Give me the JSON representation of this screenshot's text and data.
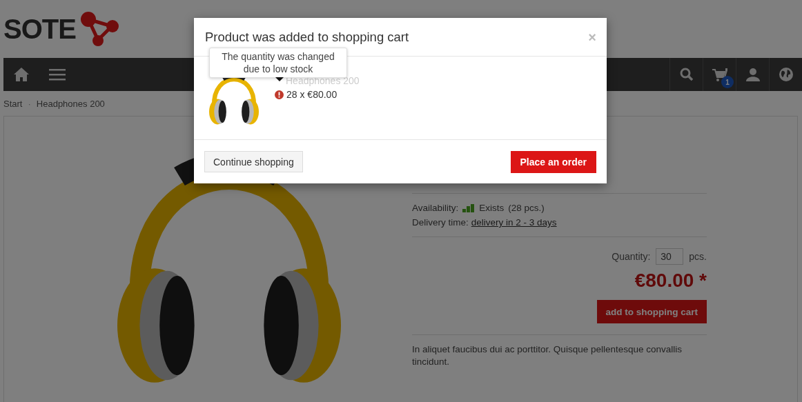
{
  "logo": {
    "text": "SOTE"
  },
  "nav": {
    "cart_badge": "1"
  },
  "breadcrumb": {
    "separator": "·",
    "items": [
      {
        "label": "Start"
      },
      {
        "label": "Headphones 200"
      }
    ]
  },
  "product": {
    "availability_label": "Availability:",
    "availability": "Exists",
    "stock": "(28 pcs.)",
    "delivery_label": "Delivery time:",
    "delivery_link": "delivery in 2 - 3 days",
    "quantity_label": "Quantity:",
    "quantity": "30",
    "quantity_unit": "pcs.",
    "price": "€80.00 *",
    "add_to_cart": "add to shopping cart",
    "description": "In aliquet faucibus dui ac porttitor. Quisque pellentesque convallis tincidunt."
  },
  "modal": {
    "title": "Product was added to shopping cart",
    "close": "×",
    "tooltip": "The quantity was changed due to low stock",
    "item_name": "Headphones 200",
    "item_line": "28 x €80.00",
    "buttons": [
      {
        "label": "Continue shopping",
        "kind": "secondary"
      },
      {
        "label": "Place an order",
        "kind": "primary"
      }
    ]
  }
}
